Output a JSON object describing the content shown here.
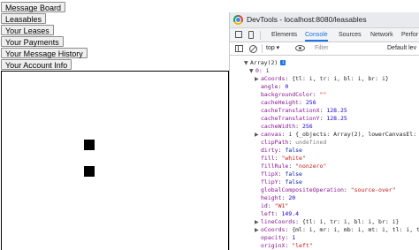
{
  "nav": {
    "buttons": [
      {
        "label": "Message Board"
      },
      {
        "label": "Leasables"
      },
      {
        "label": "Your Leases"
      },
      {
        "label": "Your Payments"
      },
      {
        "label": "Your Message History"
      },
      {
        "label": "Your Account Info"
      }
    ]
  },
  "devtools": {
    "window_title": "DevTools - localhost:8080/leasables",
    "tabs": [
      {
        "label": "Elements",
        "active": false
      },
      {
        "label": "Console",
        "active": true
      },
      {
        "label": "Sources",
        "active": false
      },
      {
        "label": "Network",
        "active": false
      },
      {
        "label": "Perfor",
        "active": false
      }
    ],
    "toolbar": {
      "context": "top ▾",
      "filter_placeholder": "Filter",
      "levels": "Default lev"
    },
    "console": {
      "root_summary": "Array(2)",
      "root_badge": "i",
      "item0": {
        "key": "0",
        "summary": "i"
      },
      "lines": [
        {
          "arrow": "▶",
          "key": "aCoords",
          "summary": "{tl: i, tr: i, bl: i, br: i}"
        },
        {
          "arrow": "",
          "key": "angle",
          "value": "0",
          "type": "num"
        },
        {
          "arrow": "",
          "key": "backgroundColor",
          "value": "\"\"",
          "type": "str"
        },
        {
          "arrow": "",
          "key": "cacheHeight",
          "value": "256",
          "type": "num"
        },
        {
          "arrow": "",
          "key": "cacheTranslationX",
          "value": "128.25",
          "type": "num"
        },
        {
          "arrow": "",
          "key": "cacheTranslationY",
          "value": "128.25",
          "type": "num"
        },
        {
          "arrow": "",
          "key": "cacheWidth",
          "value": "256",
          "type": "num"
        },
        {
          "arrow": "▶",
          "key": "canvas",
          "summary": "i {_objects: Array(2), lowerCanvasEl: canv"
        },
        {
          "arrow": "",
          "key": "clipPath",
          "value": "undefined",
          "type": "gray"
        },
        {
          "arrow": "",
          "key": "dirty",
          "value": "false",
          "type": "kw"
        },
        {
          "arrow": "",
          "key": "fill",
          "value": "\"white\"",
          "type": "str"
        },
        {
          "arrow": "",
          "key": "fillRule",
          "value": "\"nonzero\"",
          "type": "str"
        },
        {
          "arrow": "",
          "key": "flipX",
          "value": "false",
          "type": "kw"
        },
        {
          "arrow": "",
          "key": "flipY",
          "value": "false",
          "type": "kw"
        },
        {
          "arrow": "",
          "key": "globalCompositeOperation",
          "value": "\"source-over\"",
          "type": "str"
        },
        {
          "arrow": "",
          "key": "height",
          "value": "20",
          "type": "num"
        },
        {
          "arrow": "",
          "key": "id",
          "value": "\"W1\"",
          "type": "str"
        },
        {
          "arrow": "",
          "key": "left",
          "value": "149.4",
          "type": "num"
        },
        {
          "arrow": "▶",
          "key": "lineCoords",
          "summary": "{tl: i, tr: i, bl: i, br: i}"
        },
        {
          "arrow": "▶",
          "key": "oCoords",
          "summary": "{ml: i, mr: i, mb: i, mt: i, tl: i, tr: i,"
        },
        {
          "arrow": "",
          "key": "opacity",
          "value": "1",
          "type": "num"
        },
        {
          "arrow": "",
          "key": "originX",
          "value": "\"left\"",
          "type": "str"
        }
      ]
    }
  },
  "canvas": {
    "objects": [
      {
        "name": "black-square-1"
      },
      {
        "name": "black-square-2"
      }
    ]
  }
}
